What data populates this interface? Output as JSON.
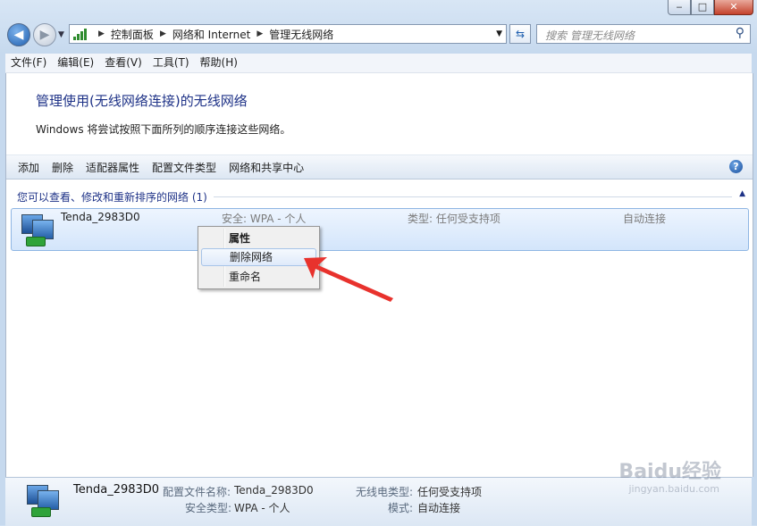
{
  "window": {
    "min": "‒",
    "max": "□",
    "close": "✕"
  },
  "address": {
    "crumbs": [
      "控制面板",
      "网络和 Internet",
      "管理无线网络"
    ]
  },
  "search": {
    "placeholder": "搜索 管理无线网络"
  },
  "menubar": [
    "文件(F)",
    "编辑(E)",
    "查看(V)",
    "工具(T)",
    "帮助(H)"
  ],
  "page": {
    "title": "管理使用(无线网络连接)的无线网络",
    "subtitle": "Windows 将尝试按照下面所列的顺序连接这些网络。"
  },
  "commands": [
    "添加",
    "删除",
    "适配器属性",
    "配置文件类型",
    "网络和共享中心"
  ],
  "group": {
    "label": "您可以查看、修改和重新排序的网络 (1)"
  },
  "network": {
    "name": "Tenda_2983D0",
    "security": "安全: WPA - 个人",
    "type": "类型: 任何受支持项",
    "mode": "自动连接"
  },
  "context_menu": [
    "属性",
    "删除网络",
    "重命名"
  ],
  "details": {
    "name": "Tenda_2983D0",
    "profile_label": "配置文件名称:",
    "profile_value": "Tenda_2983D0",
    "security_label": "安全类型:",
    "security_value": "WPA - 个人",
    "radio_label": "无线电类型:",
    "radio_value": "任何受支持项",
    "mode_label": "模式:",
    "mode_value": "自动连接"
  },
  "watermark": {
    "brand": "Baidu经验",
    "url": "jingyan.baidu.com"
  },
  "colors": {
    "title": "#1e3287",
    "selection": "#d3e5fb",
    "arrow": "#e8322d"
  }
}
